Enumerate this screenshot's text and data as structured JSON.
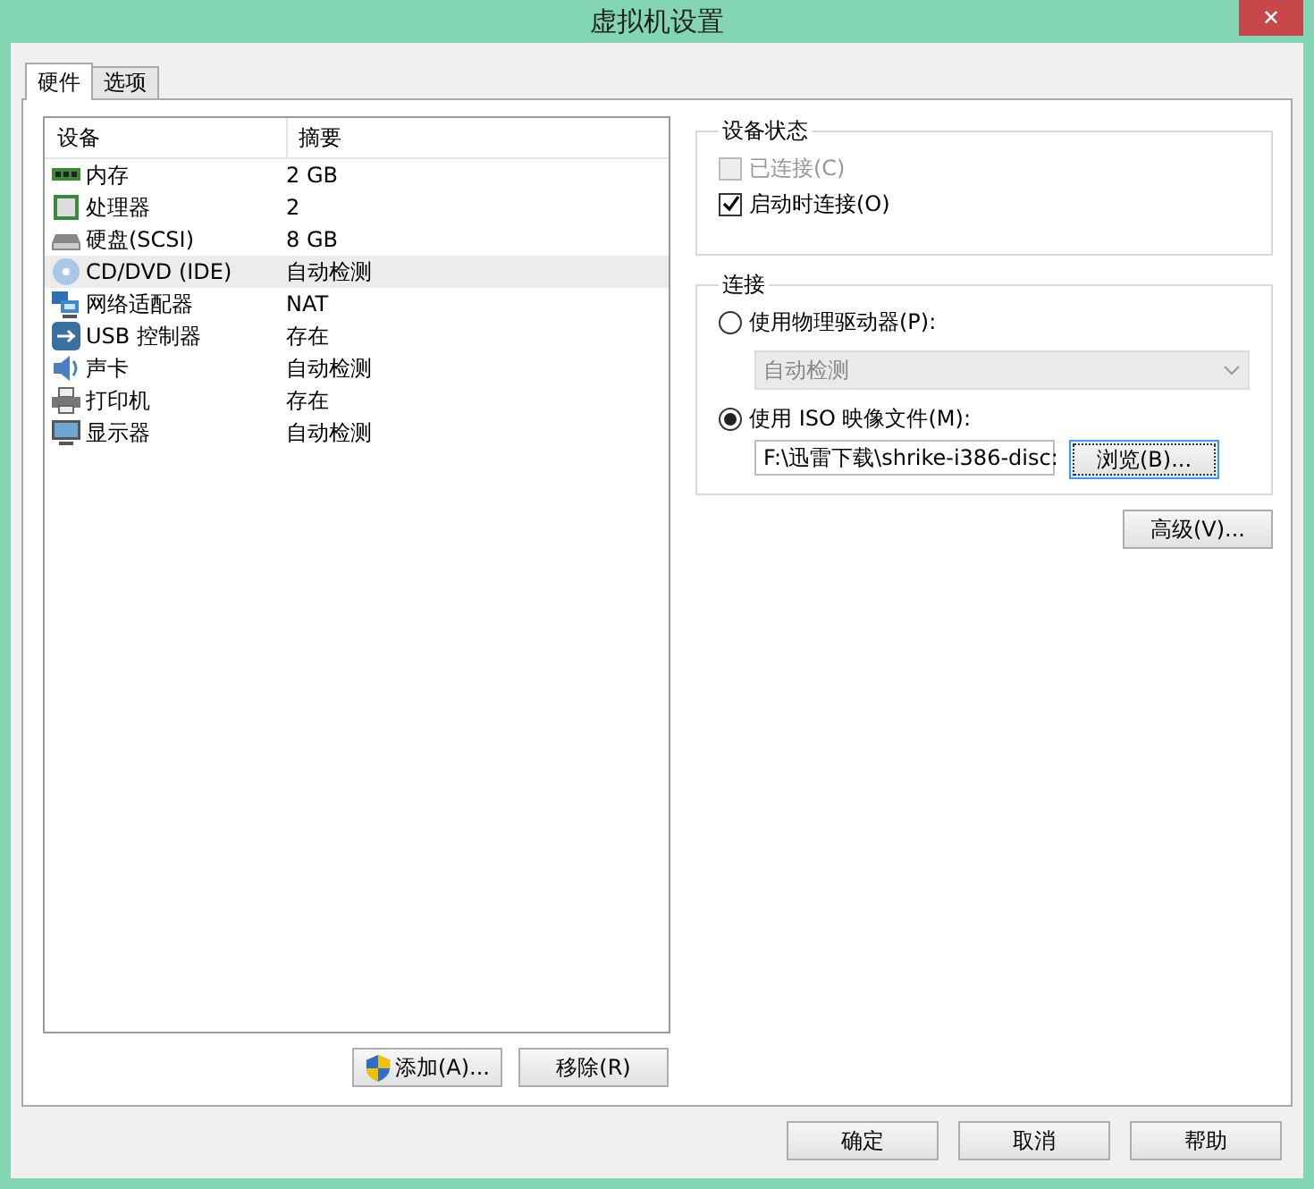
{
  "window": {
    "title": "虚拟机设置",
    "close": "✕"
  },
  "tabs": [
    {
      "label": "硬件",
      "selected": true
    },
    {
      "label": "选项",
      "selected": false
    }
  ],
  "device_table": {
    "columns": [
      "设备",
      "摘要"
    ],
    "rows": [
      {
        "kind": "memory",
        "device": "内存",
        "summary": "2 GB",
        "selected": false
      },
      {
        "kind": "cpu",
        "device": "处理器",
        "summary": "2",
        "selected": false
      },
      {
        "kind": "disk",
        "device": "硬盘(SCSI)",
        "summary": "8 GB",
        "selected": false
      },
      {
        "kind": "cd",
        "device": "CD/DVD (IDE)",
        "summary": "自动检测",
        "selected": true
      },
      {
        "kind": "network",
        "device": "网络适配器",
        "summary": "NAT",
        "selected": false
      },
      {
        "kind": "usb",
        "device": "USB 控制器",
        "summary": "存在",
        "selected": false
      },
      {
        "kind": "sound",
        "device": "声卡",
        "summary": "自动检测",
        "selected": false
      },
      {
        "kind": "printer",
        "device": "打印机",
        "summary": "存在",
        "selected": false
      },
      {
        "kind": "display",
        "device": "显示器",
        "summary": "自动检测",
        "selected": false
      }
    ]
  },
  "device_buttons": [
    "添加(A)...",
    "移除(R)"
  ],
  "device_status": {
    "title": "设备状态",
    "options": [
      {
        "label": "已连接(C)",
        "checked": false,
        "disabled": true
      },
      {
        "label": "启动时连接(O)",
        "checked": true,
        "disabled": false
      }
    ]
  },
  "connection": {
    "title": "连接",
    "physical": {
      "label": "使用物理驱动器(P):",
      "selected": false,
      "drive_value": "自动检测",
      "disabled": true
    },
    "iso": {
      "label": "使用 ISO 映像文件(M):",
      "selected": true,
      "path_value": "F:\\迅雷下载\\shrike-i386-disc:",
      "browse": "浏览(B)..."
    }
  },
  "advanced_button": "高级(V)...",
  "dialog_buttons": [
    "确定",
    "取消",
    "帮助"
  ]
}
